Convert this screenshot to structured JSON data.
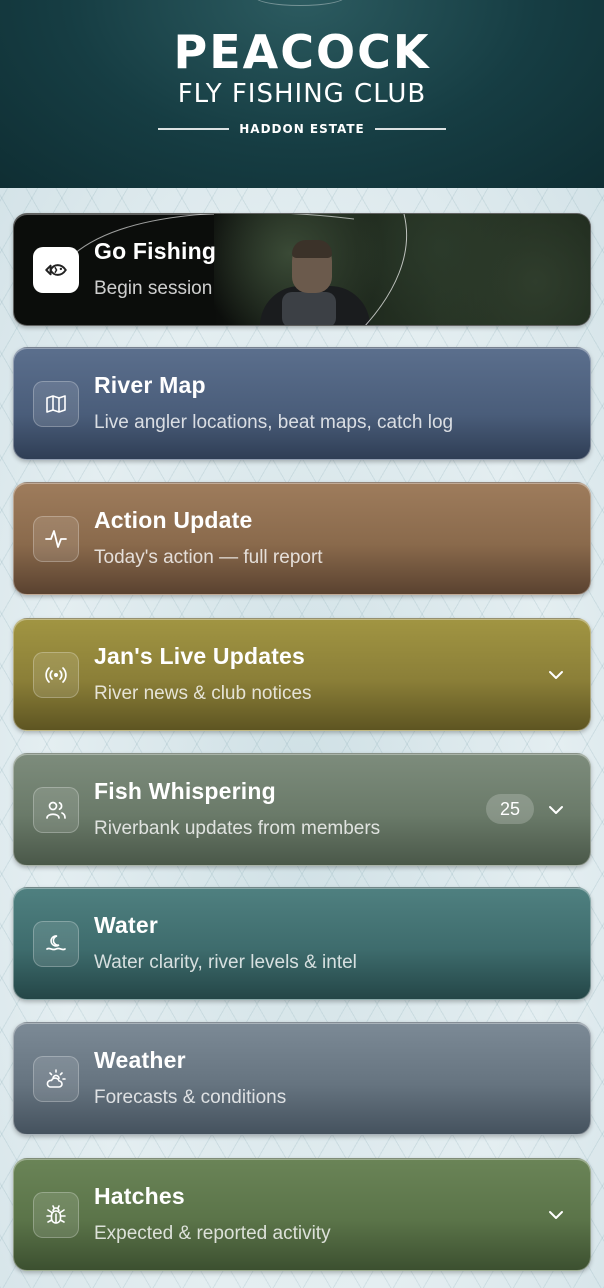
{
  "header": {
    "line1": "PEACOCK",
    "line2": "FLY FISHING CLUB",
    "line3": "HADDON ESTATE"
  },
  "cards": [
    {
      "title": "Go Fishing",
      "subtitle": "Begin session",
      "icon": "fish-icon"
    },
    {
      "title": "River Map",
      "subtitle": "Live angler locations, beat maps, catch log",
      "icon": "map-icon"
    },
    {
      "title": "Action Update",
      "subtitle": "Today's action — full report",
      "icon": "activity-icon"
    },
    {
      "title": "Jan's Live Updates",
      "subtitle": "River news & club notices",
      "icon": "broadcast-icon",
      "expandable": true
    },
    {
      "title": "Fish Whispering",
      "subtitle": "Riverbank updates from members",
      "icon": "users-icon",
      "badge": "25",
      "expandable": true
    },
    {
      "title": "Water",
      "subtitle": "Water clarity, river levels & intel",
      "icon": "water-icon"
    },
    {
      "title": "Weather",
      "subtitle": "Forecasts & conditions",
      "icon": "weather-icon"
    },
    {
      "title": "Hatches",
      "subtitle": "Expected & reported activity",
      "icon": "bug-icon",
      "expandable": true
    }
  ],
  "colors": {
    "header_bg": "#163d43",
    "river_map": "#4a5d7a",
    "action_update": "#8a6a4c",
    "jans_live_updates": "#8b7f38",
    "fish_whispering": "#6a7a69",
    "water": "#3e6c6d",
    "weather": "#667480",
    "hatches": "#5b7449"
  }
}
